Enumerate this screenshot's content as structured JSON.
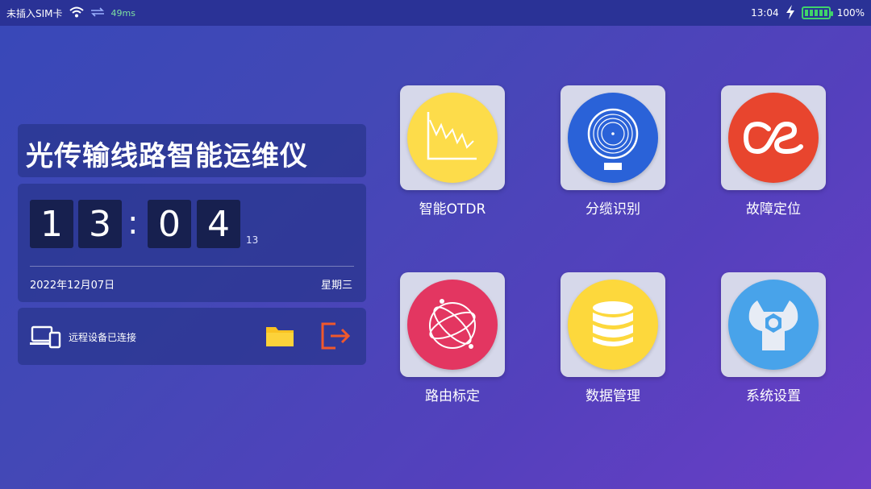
{
  "statusbar": {
    "sim": "未插入SIM卡",
    "ping": "49ms",
    "time": "13:04",
    "battery": "100%"
  },
  "panel": {
    "title": "光传输线路智能运维仪",
    "clock": {
      "h1": "1",
      "h2": "3",
      "m1": "0",
      "m2": "4",
      "colon": ":",
      "seconds": "13"
    },
    "date": "2022年12月07日",
    "weekday": "星期三",
    "connection": "远程设备已连接"
  },
  "apps": [
    {
      "label": "智能OTDR",
      "color": "#fddc4a",
      "icon": "chart-icon"
    },
    {
      "label": "分缆识别",
      "color": "#2a62d8",
      "icon": "disc-icon"
    },
    {
      "label": "故障定位",
      "color": "#e8452e",
      "icon": "lastfm-icon"
    },
    {
      "label": "路由标定",
      "color": "#e33661",
      "icon": "atom-icon"
    },
    {
      "label": "数据管理",
      "color": "#fdd83c",
      "icon": "database-icon"
    },
    {
      "label": "系统设置",
      "color": "#48a3ea",
      "icon": "wrench-icon"
    }
  ],
  "colors": {
    "accent": "#3fd46a",
    "exit": "#f0582c",
    "folder": "#f9c221"
  }
}
